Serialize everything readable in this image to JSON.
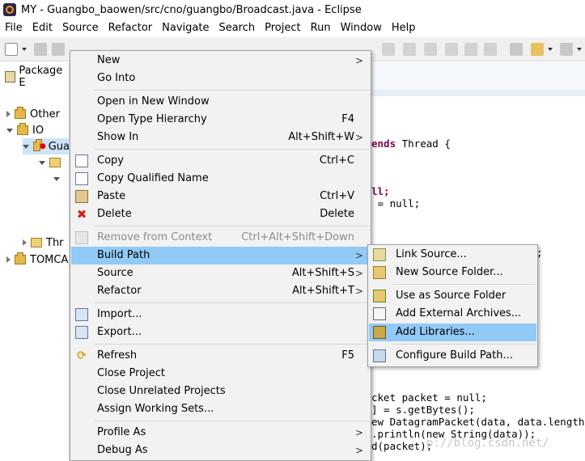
{
  "window": {
    "title": "MY - Guangbo_baowen/src/cno/guangbo/Broadcast.java - Eclipse"
  },
  "menubar": [
    "File",
    "Edit",
    "Source",
    "Refactor",
    "Navigate",
    "Search",
    "Project",
    "Run",
    "Window",
    "Help"
  ],
  "package_explorer": {
    "tab_label": "Package E",
    "tree": [
      {
        "label": "Other"
      },
      {
        "label": "IO"
      },
      {
        "label": "Gua"
      },
      {
        "label": "Thr"
      },
      {
        "label": "TOMCA"
      }
    ]
  },
  "editor": {
    "line1_kw": "ends",
    "line1_rest": " Thread {",
    "line2": "ll;",
    "line3": " = null;",
    "line4": ";",
    "line5": "cket packet = null;",
    "line6": "] = s.getBytes();",
    "line7": "ew DatagramPacket(data, data.length, g",
    "line8": ".println(new String(data));",
    "line9": "d(packet);",
    "watermark": "p://blog.csdn.net/"
  },
  "context_menu": {
    "items": [
      {
        "label": "New",
        "accel": "",
        "submenu": true,
        "icon": ""
      },
      {
        "label": "Go Into",
        "accel": "",
        "submenu": false,
        "icon": ""
      },
      {
        "label": "Open in New Window",
        "accel": "",
        "submenu": false,
        "icon": ""
      },
      {
        "label": "Open Type Hierarchy",
        "accel": "F4",
        "submenu": false,
        "icon": ""
      },
      {
        "label": "Show In",
        "accel": "Alt+Shift+W",
        "submenu": true,
        "icon": ""
      },
      {
        "label": "Copy",
        "accel": "Ctrl+C",
        "submenu": false,
        "icon": "copy-icon"
      },
      {
        "label": "Copy Qualified Name",
        "accel": "",
        "submenu": false,
        "icon": "copy-qualified-icon"
      },
      {
        "label": "Paste",
        "accel": "Ctrl+V",
        "submenu": false,
        "icon": "paste-icon"
      },
      {
        "label": "Delete",
        "accel": "Delete",
        "submenu": false,
        "icon": "delete-icon"
      },
      {
        "label": "Remove from Context",
        "accel": "Ctrl+Alt+Shift+Down",
        "submenu": false,
        "icon": "remove-context-icon",
        "disabled": true
      },
      {
        "label": "Build Path",
        "accel": "",
        "submenu": true,
        "icon": "",
        "highlighted": true
      },
      {
        "label": "Source",
        "accel": "Alt+Shift+S",
        "submenu": true,
        "icon": ""
      },
      {
        "label": "Refactor",
        "accel": "Alt+Shift+T",
        "submenu": true,
        "icon": ""
      },
      {
        "label": "Import...",
        "accel": "",
        "submenu": false,
        "icon": "import-icon"
      },
      {
        "label": "Export...",
        "accel": "",
        "submenu": false,
        "icon": "export-icon"
      },
      {
        "label": "Refresh",
        "accel": "F5",
        "submenu": false,
        "icon": "refresh-icon"
      },
      {
        "label": "Close Project",
        "accel": "",
        "submenu": false,
        "icon": ""
      },
      {
        "label": "Close Unrelated Projects",
        "accel": "",
        "submenu": false,
        "icon": ""
      },
      {
        "label": "Assign Working Sets...",
        "accel": "",
        "submenu": false,
        "icon": ""
      },
      {
        "label": "Profile As",
        "accel": "",
        "submenu": true,
        "icon": ""
      },
      {
        "label": "Debug As",
        "accel": "",
        "submenu": true,
        "icon": ""
      }
    ]
  },
  "build_path_submenu": {
    "items": [
      {
        "label": "Link Source...",
        "icon": "link-source-icon"
      },
      {
        "label": "New Source Folder...",
        "icon": "new-source-folder-icon"
      },
      {
        "label": "Use as Source Folder",
        "icon": "use-source-folder-icon"
      },
      {
        "label": "Add External Archives...",
        "icon": "external-archive-icon"
      },
      {
        "label": "Add Libraries...",
        "icon": "add-libraries-icon",
        "highlighted": true
      },
      {
        "label": "Configure Build Path...",
        "icon": "configure-build-path-icon"
      }
    ]
  },
  "colors": {
    "menu_bg": "#f2f2f2",
    "highlight": "#91c9f7",
    "keyword": "#7f0055",
    "disabled_text": "#8c8c8c"
  }
}
